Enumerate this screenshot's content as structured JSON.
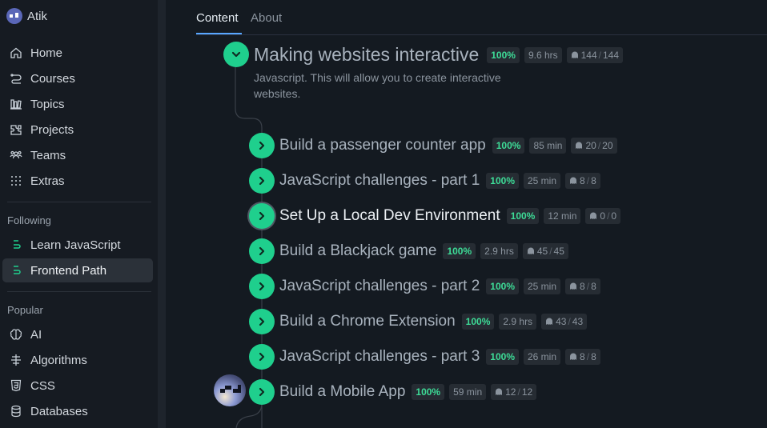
{
  "user": {
    "name": "Atik"
  },
  "nav": [
    {
      "label": "Home",
      "icon": "home-icon"
    },
    {
      "label": "Courses",
      "icon": "courses-icon"
    },
    {
      "label": "Topics",
      "icon": "topics-icon"
    },
    {
      "label": "Projects",
      "icon": "projects-icon"
    },
    {
      "label": "Teams",
      "icon": "teams-icon"
    },
    {
      "label": "Extras",
      "icon": "extras-icon"
    }
  ],
  "following": {
    "label": "Following",
    "items": [
      {
        "label": "Learn JavaScript",
        "icon": "path-icon"
      },
      {
        "label": "Frontend Path",
        "icon": "path-icon",
        "active": true
      }
    ]
  },
  "popular": {
    "label": "Popular",
    "items": [
      {
        "label": "AI",
        "icon": "brain-icon"
      },
      {
        "label": "Algorithms",
        "icon": "algorithms-icon"
      },
      {
        "label": "CSS",
        "icon": "css-icon"
      },
      {
        "label": "Databases",
        "icon": "database-icon"
      }
    ]
  },
  "tabs": [
    {
      "label": "Content",
      "active": true
    },
    {
      "label": "About",
      "active": false
    }
  ],
  "module": {
    "title": "Making websites interactive",
    "percent": "100%",
    "duration": "9.6 hrs",
    "done": "144",
    "total": "144",
    "description": "Javascript. This will allow you to create interactive websites."
  },
  "lessons": [
    {
      "title": "Build a passenger counter app",
      "percent": "100%",
      "duration": "85 min",
      "done": "20",
      "total": "20"
    },
    {
      "title": "JavaScript challenges - part 1",
      "percent": "100%",
      "duration": "25 min",
      "done": "8",
      "total": "8"
    },
    {
      "title": "Set Up a Local Dev Environment",
      "percent": "100%",
      "duration": "12 min",
      "done": "0",
      "total": "0",
      "current": true
    },
    {
      "title": "Build a Blackjack game",
      "percent": "100%",
      "duration": "2.9 hrs",
      "done": "45",
      "total": "45"
    },
    {
      "title": "JavaScript challenges - part 2",
      "percent": "100%",
      "duration": "25 min",
      "done": "8",
      "total": "8"
    },
    {
      "title": "Build a Chrome Extension",
      "percent": "100%",
      "duration": "2.9 hrs",
      "done": "43",
      "total": "43"
    },
    {
      "title": "JavaScript challenges - part 3",
      "percent": "100%",
      "duration": "26 min",
      "done": "8",
      "total": "8"
    },
    {
      "title": "Build a Mobile App",
      "percent": "100%",
      "duration": "59 min",
      "done": "12",
      "total": "12"
    }
  ],
  "colors": {
    "accent": "#1fcf8d",
    "percent": "#3ddc97",
    "tab_underline": "#58a6ff"
  }
}
